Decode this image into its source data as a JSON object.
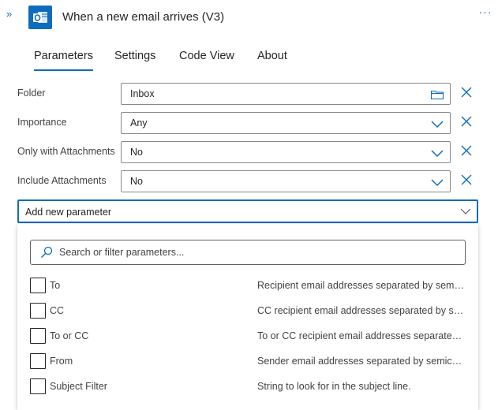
{
  "header": {
    "expand_glyph": "»",
    "app_icon": "outlook-icon",
    "title": "When a new email arrives (V3)",
    "more_glyph": "···"
  },
  "tabs": [
    {
      "label": "Parameters",
      "active": true
    },
    {
      "label": "Settings",
      "active": false
    },
    {
      "label": "Code View",
      "active": false
    },
    {
      "label": "About",
      "active": false
    }
  ],
  "parameters": [
    {
      "label": "Folder",
      "value": "Inbox",
      "icon": "folder-icon"
    },
    {
      "label": "Importance",
      "value": "Any",
      "icon": "chevron-down-icon"
    },
    {
      "label": "Only with Attachments",
      "value": "No",
      "icon": "chevron-down-icon"
    },
    {
      "label": "Include Attachments",
      "value": "No",
      "icon": "chevron-down-icon"
    }
  ],
  "add_parameter": {
    "label": "Add new parameter",
    "search_placeholder": "Search or filter parameters...",
    "options": [
      {
        "name": "To",
        "description": "Recipient email addresses separated by semicolo...",
        "checked": false
      },
      {
        "name": "CC",
        "description": "CC recipient email addresses separated by semi...",
        "checked": false
      },
      {
        "name": "To or CC",
        "description": "To or CC recipient email addresses separated b...",
        "checked": false
      },
      {
        "name": "From",
        "description": "Sender email addresses separated by semicolo...",
        "checked": false
      },
      {
        "name": "Subject Filter",
        "description": "String to look for in the subject line.",
        "checked": false
      }
    ]
  },
  "colors": {
    "accent": "#0f6cbd",
    "border": "#8a8886",
    "text": "#242424"
  }
}
